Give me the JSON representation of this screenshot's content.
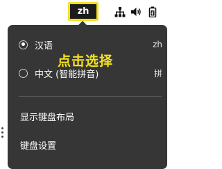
{
  "panel": {
    "input_method_indicator": "zh",
    "indicator_highlight_color": "#f4e11f",
    "icons": [
      "network-icon",
      "volume-icon",
      "battery-icon"
    ]
  },
  "menu": {
    "background": "#363636",
    "engines": [
      {
        "label": "汉语",
        "accel": "zh",
        "selected": true
      },
      {
        "label": "中文 (智能拼音)",
        "accel": "拼",
        "selected": false
      }
    ],
    "actions": [
      {
        "label": "显示键盘布局"
      },
      {
        "label": "键盘设置"
      }
    ]
  },
  "annotation": {
    "text": "点击选择",
    "color": "#f4e11f"
  }
}
